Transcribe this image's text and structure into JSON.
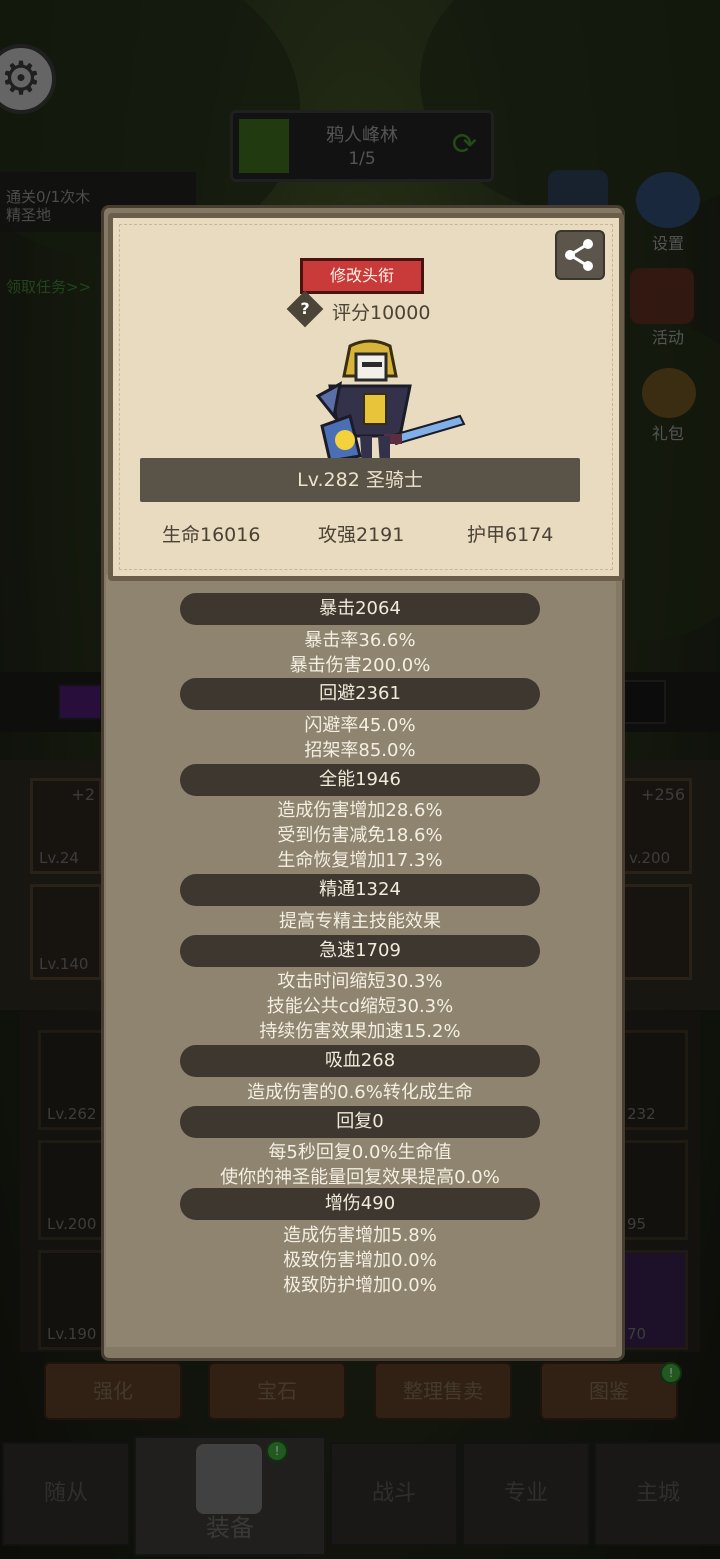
{
  "background": {
    "map": {
      "title": "鸦人峰林",
      "progress": "1/5"
    },
    "quest": {
      "line1": "通关0/1次木",
      "line2": "精圣地",
      "link": "领取任务>>"
    },
    "side_buttons": [
      {
        "label": "设置",
        "icon": "gear-icon"
      },
      {
        "label": "活动",
        "icon": "scroll-icon"
      },
      {
        "label": "礼包",
        "icon": "gift-icon"
      }
    ],
    "slots": {
      "top_left_plus": "+2",
      "top_left_lv": "Lv.24",
      "top_right_plus": "+256",
      "top_right_lv": "v.200",
      "second_left_lv": "Lv.140",
      "gear_rows": [
        {
          "left": "Lv.262",
          "right": "232"
        },
        {
          "left": "Lv.200",
          "right": "95"
        },
        {
          "left": "Lv.190",
          "right": "70"
        }
      ]
    },
    "actions": [
      "强化",
      "宝石",
      "整理售卖",
      "图鉴"
    ],
    "nav": {
      "left1": "随从",
      "active": "装备",
      "mid": "战斗",
      "right1": "专业",
      "right2": "主城"
    }
  },
  "panel": {
    "change_title_label": "修改头衔",
    "score": "评分10000",
    "level_class": "Lv.282 圣骑士",
    "hp": "生命16016",
    "attack": "攻强2191",
    "armor": "护甲6174",
    "sections": [
      {
        "title": "暴击2064",
        "lines": [
          "暴击率36.6%",
          "暴击伤害200.0%"
        ]
      },
      {
        "title": "回避2361",
        "lines": [
          "闪避率45.0%",
          "招架率85.0%"
        ]
      },
      {
        "title": "全能1946",
        "lines": [
          "造成伤害增加28.6%",
          "受到伤害减免18.6%",
          "生命恢复增加17.3%"
        ]
      },
      {
        "title": "精通1324",
        "lines": [
          "提高专精主技能效果"
        ]
      },
      {
        "title": "急速1709",
        "lines": [
          "攻击时间缩短30.3%",
          "技能公共cd缩短30.3%",
          "持续伤害效果加速15.2%"
        ]
      },
      {
        "title": "吸血268",
        "lines": [
          "造成伤害的0.6%转化成生命"
        ]
      },
      {
        "title": "回复0",
        "lines": [
          "每5秒回复0.0%生命值",
          "使你的神圣能量回复效果提高0.0%"
        ]
      },
      {
        "title": "增伤490",
        "lines": [
          "造成伤害增加5.8%",
          "极致伤害增加0.0%",
          "极致防护增加0.0%"
        ]
      }
    ]
  },
  "colors": {
    "accent_red": "#c93a3a",
    "parchment": "#e8dbc0",
    "panel": "#8e846f"
  }
}
